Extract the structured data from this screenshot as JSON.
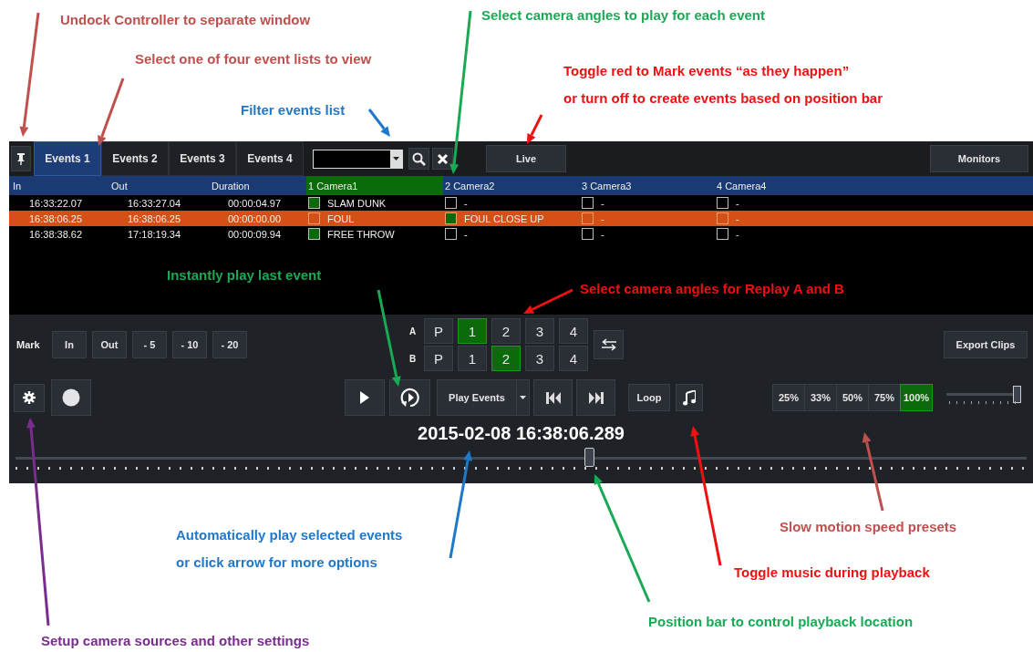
{
  "callouts": [
    {
      "text": "Undock Controller to separate window",
      "color": "#c0504d"
    },
    {
      "text": "Select camera angles to play for each event",
      "color": "#1aaa55"
    },
    {
      "text": "Select one of four event lists to view",
      "color": "#c0504d"
    },
    {
      "text": "Toggle red to Mark events “as they happen”\nor turn off to create events based on position bar",
      "color": "#ee1111"
    },
    {
      "text": "Filter events list",
      "color": "#1f78c8"
    },
    {
      "text": "Instantly play last event",
      "color": "#1aaa55"
    },
    {
      "text": "Select camera angles for Replay A and B",
      "color": "#ee1111"
    },
    {
      "text": "Slow motion speed presets",
      "color": "#c0504d"
    },
    {
      "text": "Automatically play selected events\nor click arrow for more options",
      "color": "#1f78c8"
    },
    {
      "text": "Toggle music during playback",
      "color": "#ee1111"
    },
    {
      "text": "Position bar to control playback location",
      "color": "#1aaa55"
    },
    {
      "text": "Setup camera sources and other settings",
      "color": "#7b2c8f"
    }
  ],
  "controller": {
    "tabs": [
      {
        "label": "Events 1",
        "selected": true
      },
      {
        "label": "Events 2",
        "selected": false
      },
      {
        "label": "Events 3",
        "selected": false
      },
      {
        "label": "Events 4",
        "selected": false
      }
    ],
    "live_button": "Live",
    "monitors_button": "Monitors",
    "table": {
      "columns": [
        {
          "label": "In",
          "selected": false
        },
        {
          "label": "Out",
          "selected": false
        },
        {
          "label": "Duration",
          "selected": false
        },
        {
          "label": "1 Camera1",
          "selected": true
        },
        {
          "label": "2 Camera2",
          "selected": false
        },
        {
          "label": "3 Camera3",
          "selected": false
        },
        {
          "label": "4 Camera4",
          "selected": false
        }
      ],
      "rows": [
        {
          "selected": false,
          "in": "16:33:22.07",
          "out": "16:33:27.04",
          "duration": "00:00:04.97",
          "cameras": [
            {
              "checked": true,
              "label": "SLAM DUNK"
            },
            {
              "checked": false,
              "label": "-"
            },
            {
              "checked": false,
              "label": "-"
            },
            {
              "checked": false,
              "label": "-"
            }
          ]
        },
        {
          "selected": true,
          "in": "16:38:06.25",
          "out": "16:38:06.25",
          "duration": "00:00:00.00",
          "cameras": [
            {
              "checked": false,
              "label": "FOUL"
            },
            {
              "checked": true,
              "label": "FOUL CLOSE UP"
            },
            {
              "checked": false,
              "label": "-"
            },
            {
              "checked": false,
              "label": "-"
            }
          ]
        },
        {
          "selected": false,
          "in": "16:38:38.62",
          "out": "17:18:19.34",
          "duration": "00:00:09.94",
          "cameras": [
            {
              "checked": true,
              "label": "FREE THROW"
            },
            {
              "checked": false,
              "label": "-"
            },
            {
              "checked": false,
              "label": "-"
            },
            {
              "checked": false,
              "label": "-"
            }
          ]
        }
      ]
    },
    "mark": {
      "label": "Mark",
      "buttons": [
        "In",
        "Out",
        "- 5",
        "- 10",
        "- 20"
      ]
    },
    "replay": [
      {
        "label": "A",
        "buttons": [
          {
            "label": "P",
            "selected": false
          },
          {
            "label": "1",
            "selected": true
          },
          {
            "label": "2",
            "selected": false
          },
          {
            "label": "3",
            "selected": false
          },
          {
            "label": "4",
            "selected": false
          }
        ]
      },
      {
        "label": "B",
        "buttons": [
          {
            "label": "P",
            "selected": false
          },
          {
            "label": "1",
            "selected": false
          },
          {
            "label": "2",
            "selected": true
          },
          {
            "label": "3",
            "selected": false
          },
          {
            "label": "4",
            "selected": false
          }
        ]
      }
    ],
    "export_button": "Export Clips",
    "play_events_button": "Play Events",
    "loop_button": "Loop",
    "speed_presets": [
      {
        "label": "25%",
        "selected": false
      },
      {
        "label": "33%",
        "selected": false
      },
      {
        "label": "50%",
        "selected": false
      },
      {
        "label": "75%",
        "selected": false
      },
      {
        "label": "100%",
        "selected": true
      }
    ],
    "speed_slider": {
      "level": 1
    },
    "timestamp": "2015-02-08 16:38:06.289",
    "position_bar": {
      "level": 0.567
    }
  }
}
